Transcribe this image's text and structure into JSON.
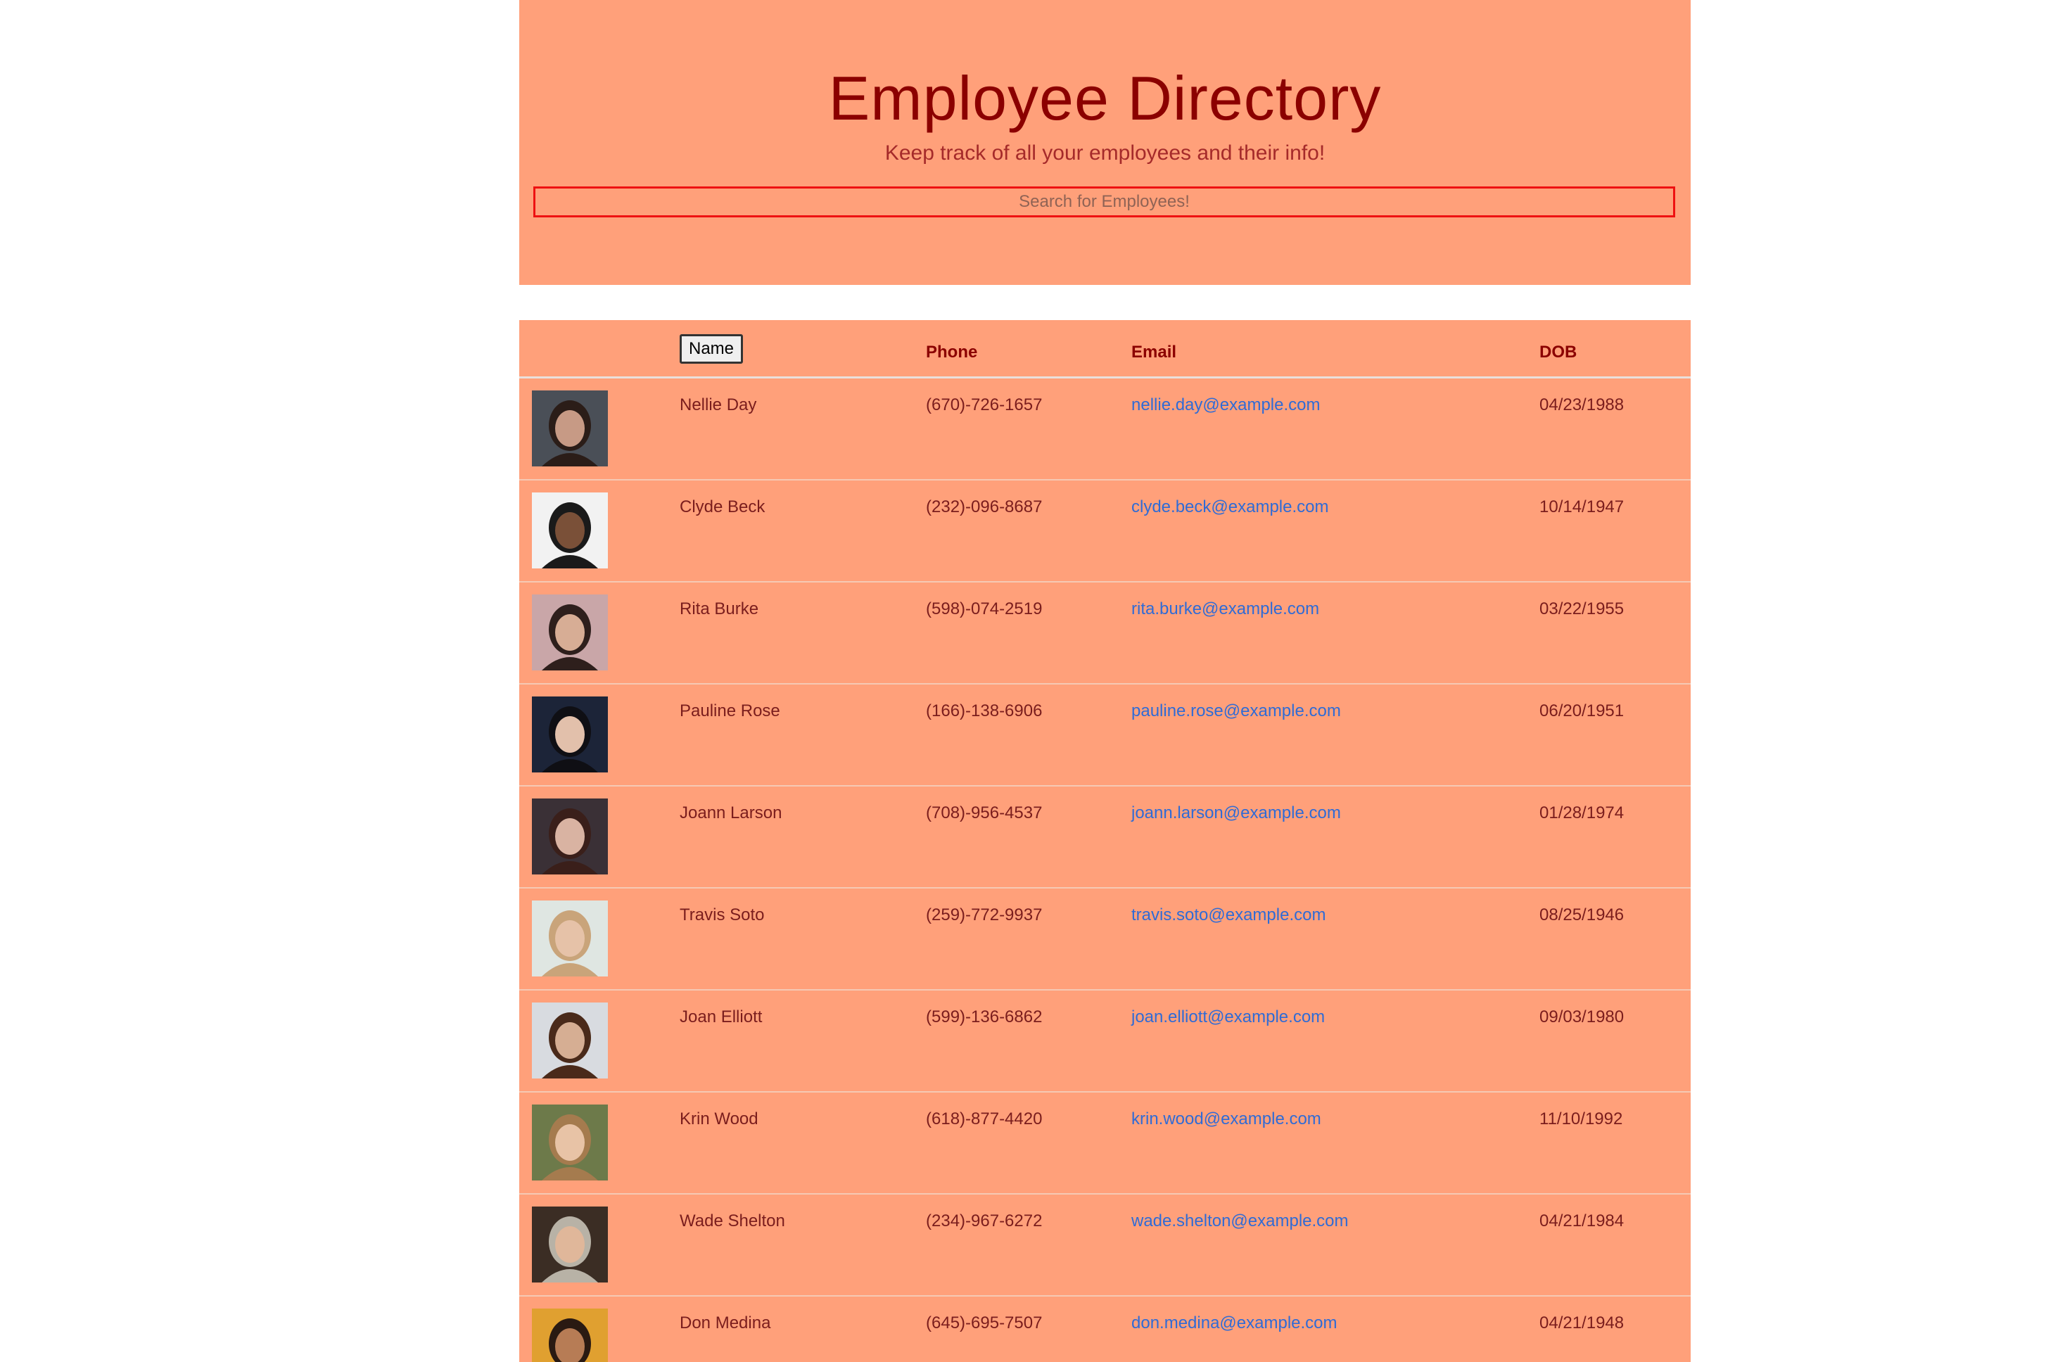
{
  "header": {
    "title": "Employee Directory",
    "subtitle": "Keep track of all your employees and their info!",
    "search_placeholder": "Search for Employees!"
  },
  "table": {
    "columns": {
      "name": "Name",
      "phone": "Phone",
      "email": "Email",
      "dob": "DOB"
    },
    "rows": [
      {
        "name": "Nellie Day",
        "phone": "(670)-726-1657",
        "email": "nellie.day@example.com",
        "dob": "04/23/1988"
      },
      {
        "name": "Clyde Beck",
        "phone": "(232)-096-8687",
        "email": "clyde.beck@example.com",
        "dob": "10/14/1947"
      },
      {
        "name": "Rita Burke",
        "phone": "(598)-074-2519",
        "email": "rita.burke@example.com",
        "dob": "03/22/1955"
      },
      {
        "name": "Pauline Rose",
        "phone": "(166)-138-6906",
        "email": "pauline.rose@example.com",
        "dob": "06/20/1951"
      },
      {
        "name": "Joann Larson",
        "phone": "(708)-956-4537",
        "email": "joann.larson@example.com",
        "dob": "01/28/1974"
      },
      {
        "name": "Travis Soto",
        "phone": "(259)-772-9937",
        "email": "travis.soto@example.com",
        "dob": "08/25/1946"
      },
      {
        "name": "Joan Elliott",
        "phone": "(599)-136-6862",
        "email": "joan.elliott@example.com",
        "dob": "09/03/1980"
      },
      {
        "name": "Krin Wood",
        "phone": "(618)-877-4420",
        "email": "krin.wood@example.com",
        "dob": "11/10/1992"
      },
      {
        "name": "Wade Shelton",
        "phone": "(234)-967-6272",
        "email": "wade.shelton@example.com",
        "dob": "04/21/1984"
      },
      {
        "name": "Don Medina",
        "phone": "(645)-695-7507",
        "email": "don.medina@example.com",
        "dob": "04/21/1948"
      }
    ]
  },
  "colors": {
    "background": "#ffa07a",
    "title": "#8b0000",
    "link": "#2f6bd6",
    "search_border": "#ee1111"
  }
}
